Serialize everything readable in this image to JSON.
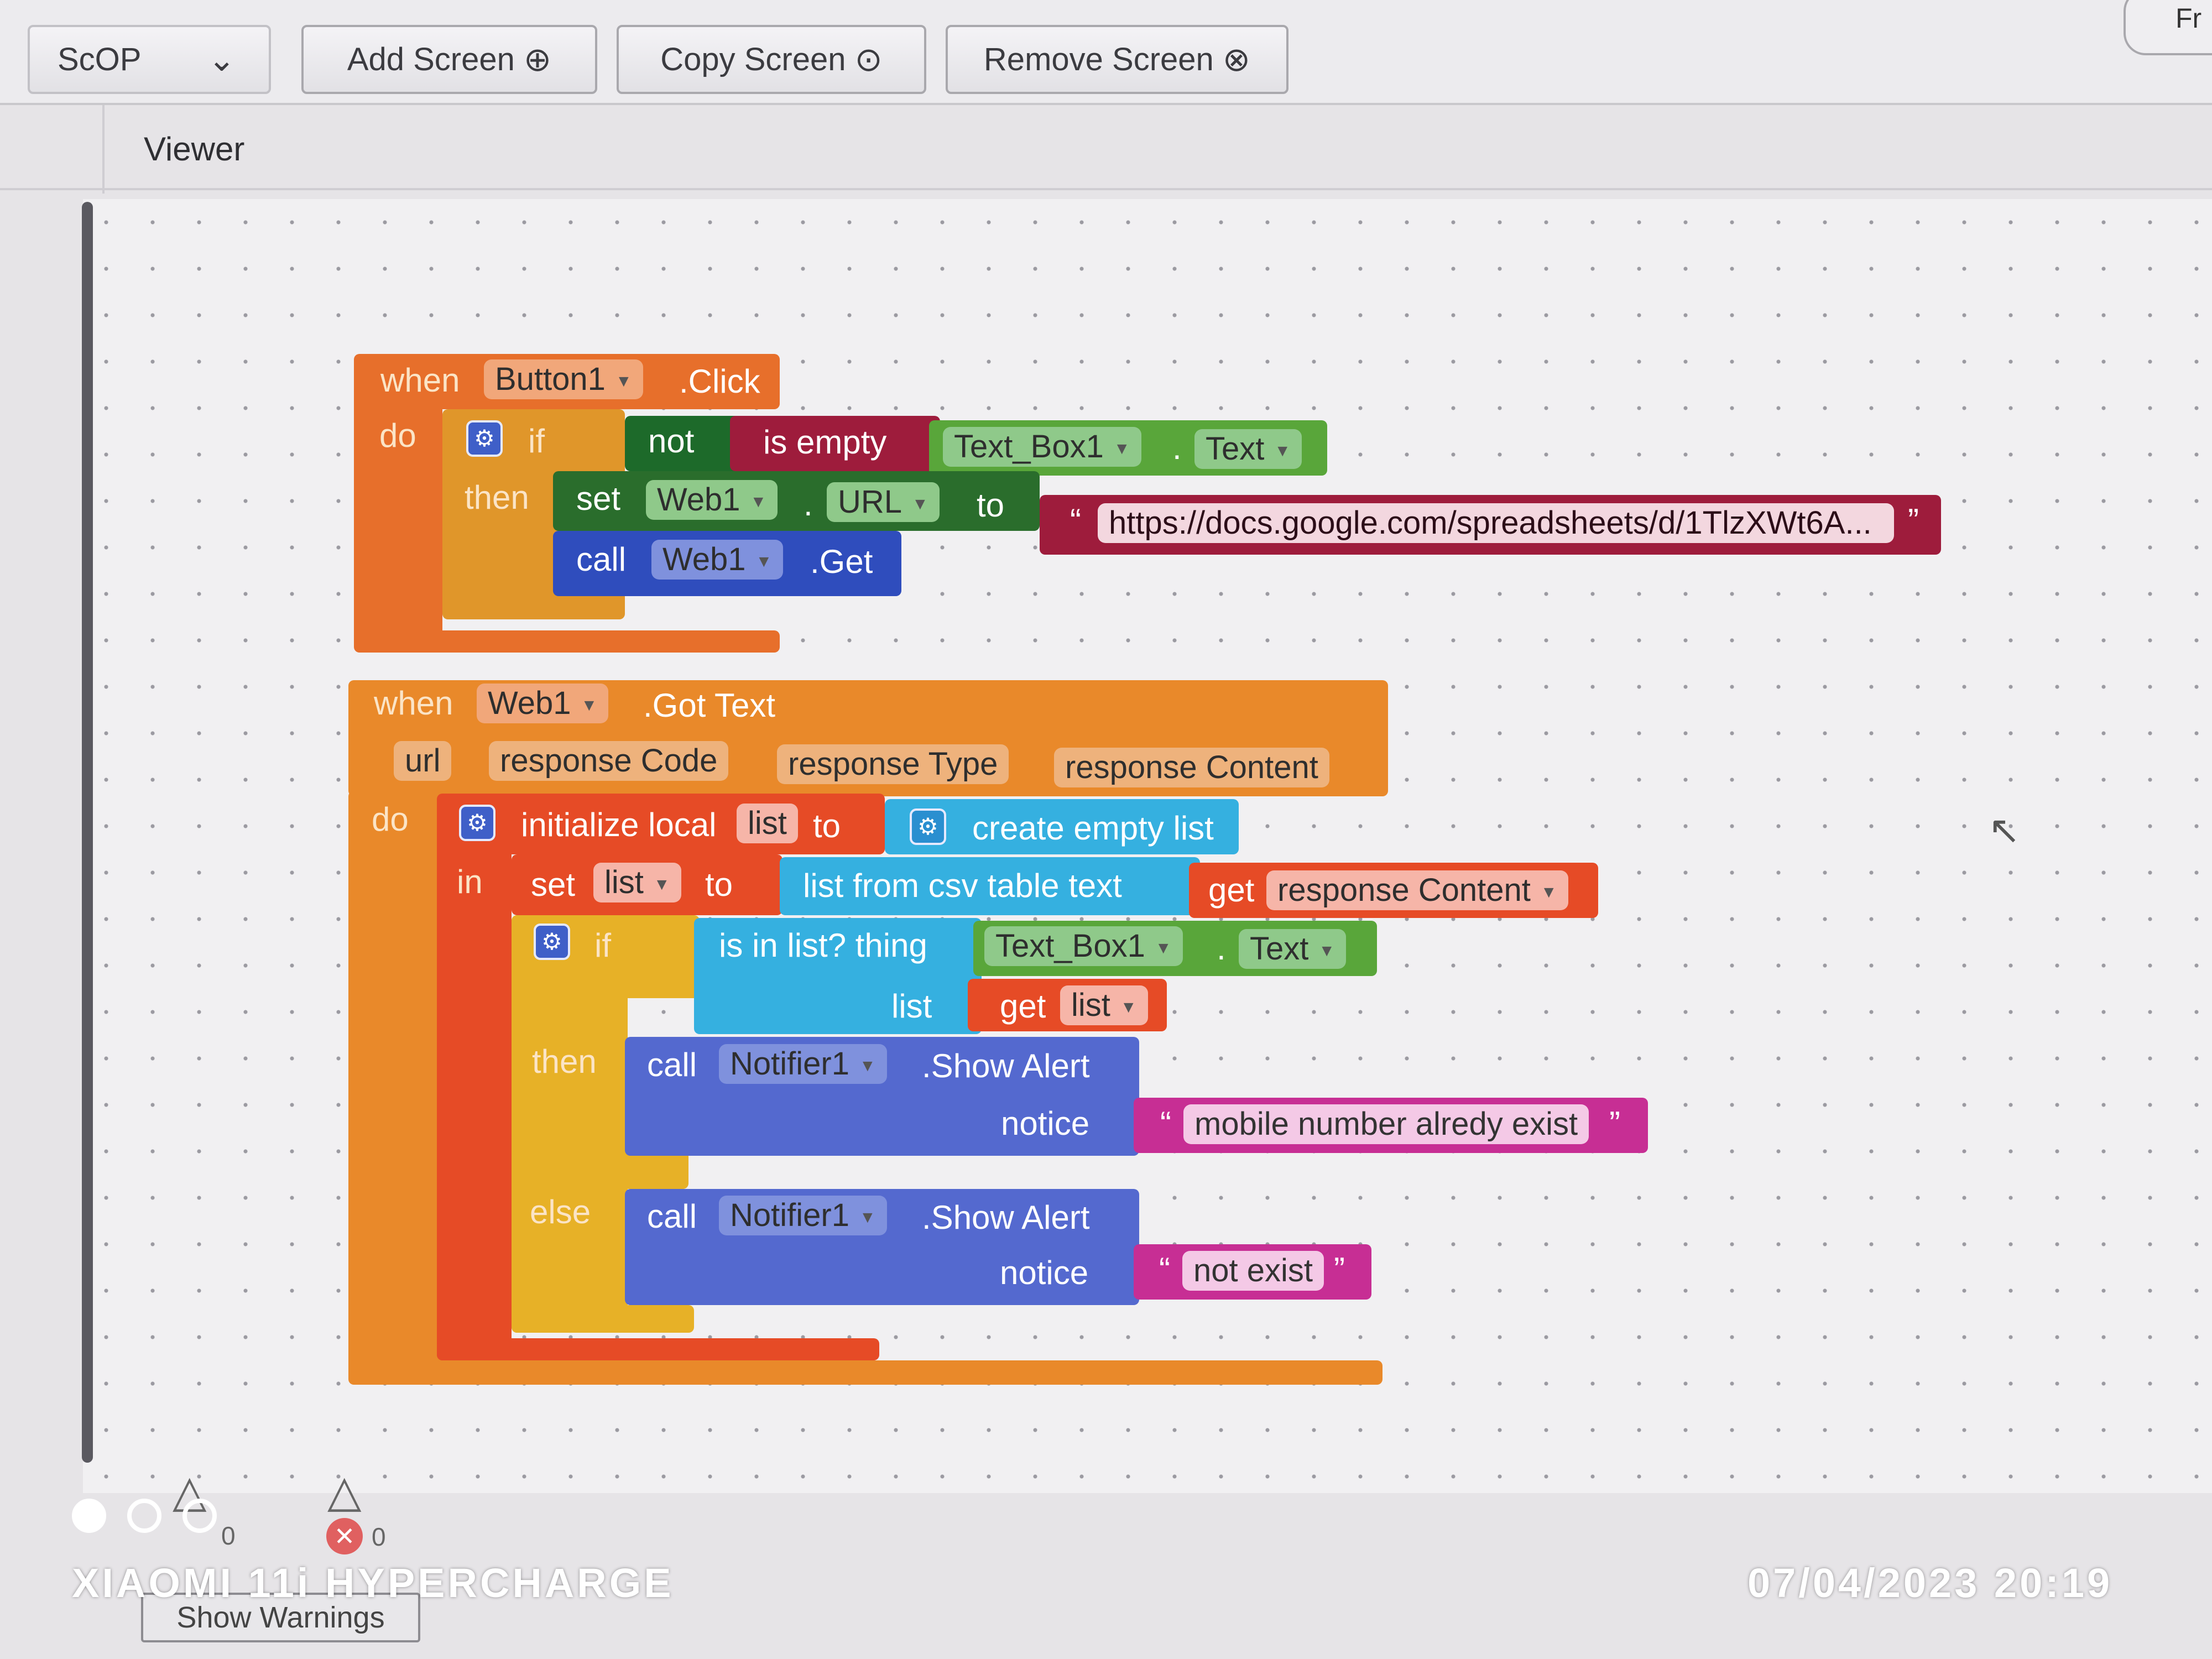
{
  "toolbar": {
    "screen_select": "ScOP",
    "screen_select_icon": "chevron-down-circle-icon",
    "add_screen": "Add Screen",
    "add_screen_icon": "⊕",
    "copy_screen": "Copy Screen",
    "copy_screen_icon": "⊙",
    "remove_screen": "Remove Screen",
    "remove_screen_icon": "⊗",
    "corner_button": "Fr"
  },
  "viewer": {
    "label": "Viewer"
  },
  "block1": {
    "when": "when",
    "component": "Button1",
    "event": ".Click",
    "do": "do",
    "if": "if",
    "then": "then",
    "not": "not",
    "is_empty": "is empty",
    "textbox": "Text_Box1",
    "dot": ".",
    "text_prop": "Text",
    "set": "set",
    "web": "Web1",
    "url_prop": "URL",
    "to": "to",
    "quote_open": "“",
    "quote_close": "”",
    "url_value": "https://docs.google.com/spreadsheets/d/1TlzXWt6A...",
    "call": "call",
    "get_method": ".Get"
  },
  "block2": {
    "when": "when",
    "component": "Web1",
    "event": ".Got Text",
    "params": [
      "url",
      "response Code",
      "response Type",
      "response Content"
    ],
    "do": "do",
    "in": "in",
    "initialize_local": "initialize local",
    "var_name": "list",
    "to": "to",
    "create_empty_list": "create empty list",
    "set": "set",
    "list_from_csv": "list from csv table  text",
    "get": "get",
    "response_content": "response Content",
    "if": "if",
    "is_in_list": "is in list? thing",
    "textbox": "Text_Box1",
    "dot": ".",
    "text_prop": "Text",
    "list_label": "list",
    "then": "then",
    "else": "else",
    "call": "call",
    "notifier": "Notifier1",
    "show_alert": ".Show Alert",
    "notice": "notice",
    "quote_open": "“",
    "quote_close": "”",
    "msg_exists": "mobile number alredy exist",
    "msg_not_exists": "not exist"
  },
  "footer": {
    "warning_count": "0",
    "error_count": "0",
    "show_warnings": "Show Warnings",
    "device": "XIAOMI 11i HYPERCHARGE",
    "datetime": "07/04/2023  20:19"
  },
  "colors": {
    "event": "#e76f2b",
    "control": "#e0962a",
    "logic": "#1d6a2a",
    "text": "#9e1c3c",
    "procedure": "#2f4dbd",
    "list": "#35b0e0",
    "variable": "#e64b26"
  }
}
